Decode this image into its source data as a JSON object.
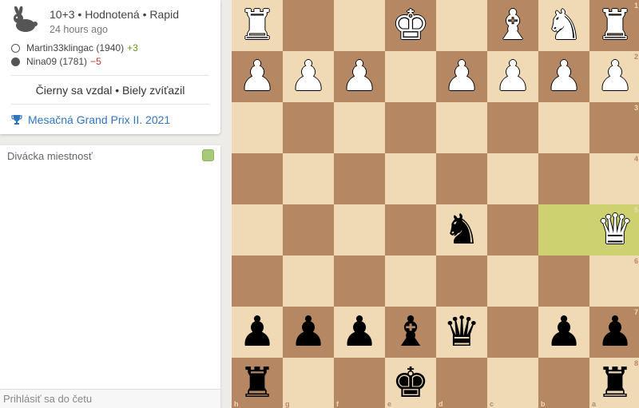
{
  "game": {
    "type_line": "10+3 • Hodnotená • Rapid",
    "time_ago": "24 hours ago",
    "players": [
      {
        "color": "white",
        "name": "Martin33klingac (1940)",
        "diff": "+3",
        "diff_kind": "good"
      },
      {
        "color": "black",
        "name": "Nina09 (1781)",
        "diff": "−5",
        "diff_kind": "bad"
      }
    ],
    "result": "Čierny sa vzdal • Biely zvíťazil",
    "tournament": "Mesačná Grand Prix II. 2021"
  },
  "chat": {
    "title": "Divácka miestnosť",
    "input_placeholder": "Prihlásiť sa do četu"
  },
  "board": {
    "orientation": "black",
    "ranks": [
      "1",
      "2",
      "3",
      "4",
      "5",
      "6",
      "7",
      "8"
    ],
    "files": [
      "h",
      "g",
      "f",
      "e",
      "d",
      "c",
      "b",
      "a"
    ],
    "highlight_squares": [
      "b5",
      "a5"
    ],
    "pieces": [
      {
        "sq": "h1",
        "p": "♜",
        "c": "w"
      },
      {
        "sq": "e1",
        "p": "♚",
        "c": "w"
      },
      {
        "sq": "c1",
        "p": "♝",
        "c": "w"
      },
      {
        "sq": "b1",
        "p": "♞",
        "c": "w"
      },
      {
        "sq": "a1",
        "p": "♜",
        "c": "w"
      },
      {
        "sq": "h2",
        "p": "♟",
        "c": "w"
      },
      {
        "sq": "g2",
        "p": "♟",
        "c": "w"
      },
      {
        "sq": "f2",
        "p": "♟",
        "c": "w"
      },
      {
        "sq": "d2",
        "p": "♟",
        "c": "w"
      },
      {
        "sq": "c2",
        "p": "♟",
        "c": "w"
      },
      {
        "sq": "b2",
        "p": "♟",
        "c": "w"
      },
      {
        "sq": "a2",
        "p": "♟",
        "c": "w"
      },
      {
        "sq": "d5",
        "p": "♞",
        "c": "b"
      },
      {
        "sq": "a5",
        "p": "♛",
        "c": "w"
      },
      {
        "sq": "h7",
        "p": "♟",
        "c": "b"
      },
      {
        "sq": "g7",
        "p": "♟",
        "c": "b"
      },
      {
        "sq": "f7",
        "p": "♟",
        "c": "b"
      },
      {
        "sq": "e7",
        "p": "♝",
        "c": "b"
      },
      {
        "sq": "d7",
        "p": "♛",
        "c": "b"
      },
      {
        "sq": "b7",
        "p": "♟",
        "c": "b"
      },
      {
        "sq": "a7",
        "p": "♟",
        "c": "b"
      },
      {
        "sq": "h8",
        "p": "♜",
        "c": "b"
      },
      {
        "sq": "e8",
        "p": "♚",
        "c": "b"
      },
      {
        "sq": "a8",
        "p": "♜",
        "c": "b"
      }
    ]
  }
}
